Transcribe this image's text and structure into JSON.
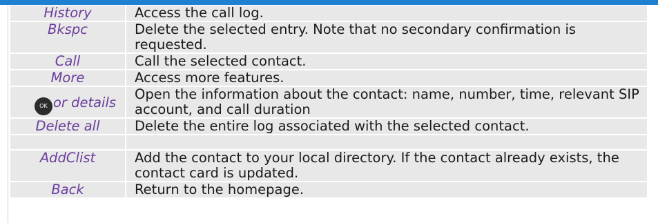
{
  "accent_color": "#1f7fd1",
  "key_color": "#6a3e9c",
  "rows": [
    {
      "key": "History",
      "desc": "Access the call log."
    },
    {
      "key": "Bkspc",
      "desc": "Delete the selected entry. Note that no secondary confirmation is requested."
    },
    {
      "key": "Call",
      "desc": "Call the selected contact."
    },
    {
      "key": "More",
      "desc": "Access more features."
    },
    {
      "icon": "ok-button-icon",
      "icon_text": "OK",
      "key": "or details",
      "desc": "Open the information about the contact: name, number, time, relevant SIP account, and call duration"
    },
    {
      "key": "Delete all",
      "desc": "Delete the entire log associated with the selected contact."
    },
    {
      "key": "",
      "desc": ""
    },
    {
      "key": "AddClist",
      "desc": "Add the contact to your local directory. If the contact already exists, the contact card is updated."
    },
    {
      "key": "Back",
      "desc": "Return to the homepage."
    }
  ]
}
